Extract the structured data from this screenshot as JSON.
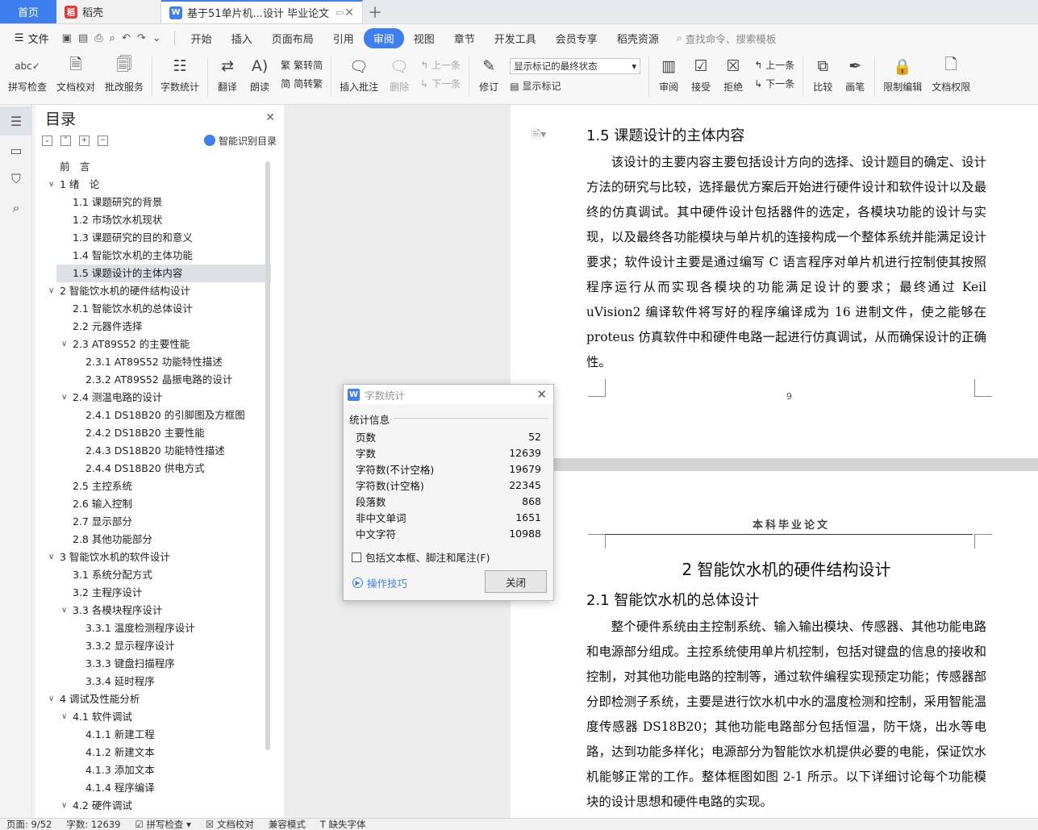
{
  "tabs": {
    "home": "首页",
    "daoke": "稻壳",
    "doc_title": "基于51单片机...设计 毕业论文"
  },
  "menu": {
    "file": "文件",
    "items": [
      "开始",
      "插入",
      "页面布局",
      "引用",
      "审阅",
      "视图",
      "章节",
      "开发工具",
      "会员专享",
      "稻壳资源"
    ],
    "active_index": 4,
    "search": "查找命令、搜索模板"
  },
  "ribbon": {
    "spell": "拼写检查",
    "doc_check": "文档校对",
    "batch": "批改服务",
    "word_count": "字数统计",
    "translate": "翻译",
    "read": "朗读",
    "trad": "繁转简",
    "simp": "简转繁",
    "insert_comment": "插入批注",
    "delete": "删除",
    "prev1": "上一条",
    "next1": "下一条",
    "revise": "修订",
    "show_state": "显示标记的最终状态",
    "show_marks": "显示标记",
    "review": "审阅",
    "accept": "接受",
    "reject": "拒绝",
    "prev2": "上一条",
    "next2": "下一条",
    "compare": "比较",
    "pen": "画笔",
    "restrict": "限制编辑",
    "perm": "文档权限"
  },
  "toc": {
    "title": "目录",
    "smart": "智能识别目录",
    "items": [
      {
        "text": "前　言",
        "level": 0,
        "arrow": false
      },
      {
        "text": "1 绪　论",
        "level": 0,
        "arrow": true
      },
      {
        "text": "1.1  课题研究的背景",
        "level": 1,
        "arrow": false
      },
      {
        "text": "1.2  市场饮水机现状",
        "level": 1,
        "arrow": false
      },
      {
        "text": "1.3  课题研究的目的和意义",
        "level": 1,
        "arrow": false
      },
      {
        "text": "1.4  智能饮水机的主体功能",
        "level": 1,
        "arrow": false
      },
      {
        "text": "1.5  课题设计的主体内容",
        "level": 1,
        "arrow": false
      },
      {
        "text": "2  智能饮水机的硬件结构设计",
        "level": 0,
        "arrow": true
      },
      {
        "text": "2.1  智能饮水机的总体设计",
        "level": 1,
        "arrow": false
      },
      {
        "text": "2.2  元器件选择",
        "level": 1,
        "arrow": false
      },
      {
        "text": "2.3 AT89S52 的主要性能",
        "level": 1,
        "arrow": true
      },
      {
        "text": "2.3.1 AT89S52 功能特性描述",
        "level": 2,
        "arrow": false
      },
      {
        "text": "2.3.2 AT89S52 晶振电路的设计",
        "level": 2,
        "arrow": false
      },
      {
        "text": "2.4  测温电路的设计",
        "level": 1,
        "arrow": true
      },
      {
        "text": "2.4.1 DS18B20 的引脚图及方框图",
        "level": 2,
        "arrow": false
      },
      {
        "text": "2.4.2 DS18B20 主要性能",
        "level": 2,
        "arrow": false
      },
      {
        "text": "2.4.3 DS18B20 功能特性描述",
        "level": 2,
        "arrow": false
      },
      {
        "text": "2.4.4 DS18B20 供电方式",
        "level": 2,
        "arrow": false
      },
      {
        "text": "2.5  主控系统",
        "level": 1,
        "arrow": false
      },
      {
        "text": "2.6  输入控制",
        "level": 1,
        "arrow": false
      },
      {
        "text": "2.7  显示部分",
        "level": 1,
        "arrow": false
      },
      {
        "text": "2.8  其他功能部分",
        "level": 1,
        "arrow": false
      },
      {
        "text": "3  智能饮水机的软件设计",
        "level": 0,
        "arrow": true
      },
      {
        "text": "3.1  系统分配方式",
        "level": 1,
        "arrow": false
      },
      {
        "text": "3.2  主程序设计",
        "level": 1,
        "arrow": false
      },
      {
        "text": "3.3  各模块程序设计",
        "level": 1,
        "arrow": true
      },
      {
        "text": "3.3.1  温度检测程序设计",
        "level": 2,
        "arrow": false
      },
      {
        "text": "3.3.2  显示程序设计",
        "level": 2,
        "arrow": false
      },
      {
        "text": "3.3.3  键盘扫描程序",
        "level": 2,
        "arrow": false
      },
      {
        "text": "3.3.4  延时程序",
        "level": 2,
        "arrow": false
      },
      {
        "text": "4  调试及性能分析",
        "level": 0,
        "arrow": true
      },
      {
        "text": "4.1  软件调试",
        "level": 1,
        "arrow": true
      },
      {
        "text": "4.1.1  新建工程",
        "level": 2,
        "arrow": false
      },
      {
        "text": "4.1.2  新建文本",
        "level": 2,
        "arrow": false
      },
      {
        "text": "4.1.3  添加文本",
        "level": 2,
        "arrow": false
      },
      {
        "text": "4.1.4  程序编译",
        "level": 2,
        "arrow": false
      },
      {
        "text": "4.2  硬件调试",
        "level": 1,
        "arrow": true
      }
    ],
    "selected_index": 6
  },
  "doc": {
    "h15": "1.5  课题设计的主体内容",
    "p1": "该设计的主要内容主要包括设计方向的选择、设计题目的确定、设计方法的研究与比较，选择最优方案后开始进行硬件设计和软件设计以及最终的仿真调试。其中硬件设计包括器件的选定，各模块功能的设计与实现，以及最终各功能模块与单片机的连接构成一个整体系统并能满足设计要求；软件设计主要是通过编写 C 语言程序对单片机进行控制使其按照程序运行从而实现各模块的功能满足设计的要求；最终通过 Keil uVision2 编译软件将写好的程序编译成为 16 进制文件，使之能够在 proteus 仿真软件中和硬件电路一起进行仿真调试，从而确保设计的正确性。",
    "page_no": "9",
    "header": "本科毕业论文",
    "h2": "2  智能饮水机的硬件结构设计",
    "h21": "2.1  智能饮水机的总体设计",
    "p2": "整个硬件系统由主控制系统、输入输出模块、传感器、其他功能电路和电源部分组成。主控系统使用单片机控制，包括对键盘的信息的接收和控制，对其他功能电路的控制等，通过软件编程实现预定功能；传感器部分即检测子系统，主要是进行饮水机中水的温度检测和控制，采用智能温度传感器 DS18B20；其他功能电路部分包括恒温，防干烧，出水等电路，达到功能多样化；电源部分为智能饮水机提供必要的电能，保证饮水机能够正常的工作。整体框图如图 2-1 所示。以下详细讨论每个功能模块的设计思想和硬件电路的实现。"
  },
  "dialog": {
    "title": "字数统计",
    "group": "统计信息",
    "rows": [
      {
        "label": "页数",
        "value": "52"
      },
      {
        "label": "字数",
        "value": "12639"
      },
      {
        "label": "字符数(不计空格)",
        "value": "19679"
      },
      {
        "label": "字符数(计空格)",
        "value": "22345"
      },
      {
        "label": "段落数",
        "value": "868"
      },
      {
        "label": "非中文单词",
        "value": "1651"
      },
      {
        "label": "中文字符",
        "value": "10988"
      }
    ],
    "include": "包括文本框、脚注和尾注(F)",
    "tips": "操作技巧",
    "close": "关闭"
  },
  "status": {
    "page": "页面: 9/52",
    "words": "字数: 12639",
    "spell": "拼写检查",
    "check": "文档校对",
    "mode": "兼容模式",
    "font": "缺失字体"
  },
  "colors": {
    "accent": "#3d7ef0",
    "wps_red": "#e33a3a"
  }
}
